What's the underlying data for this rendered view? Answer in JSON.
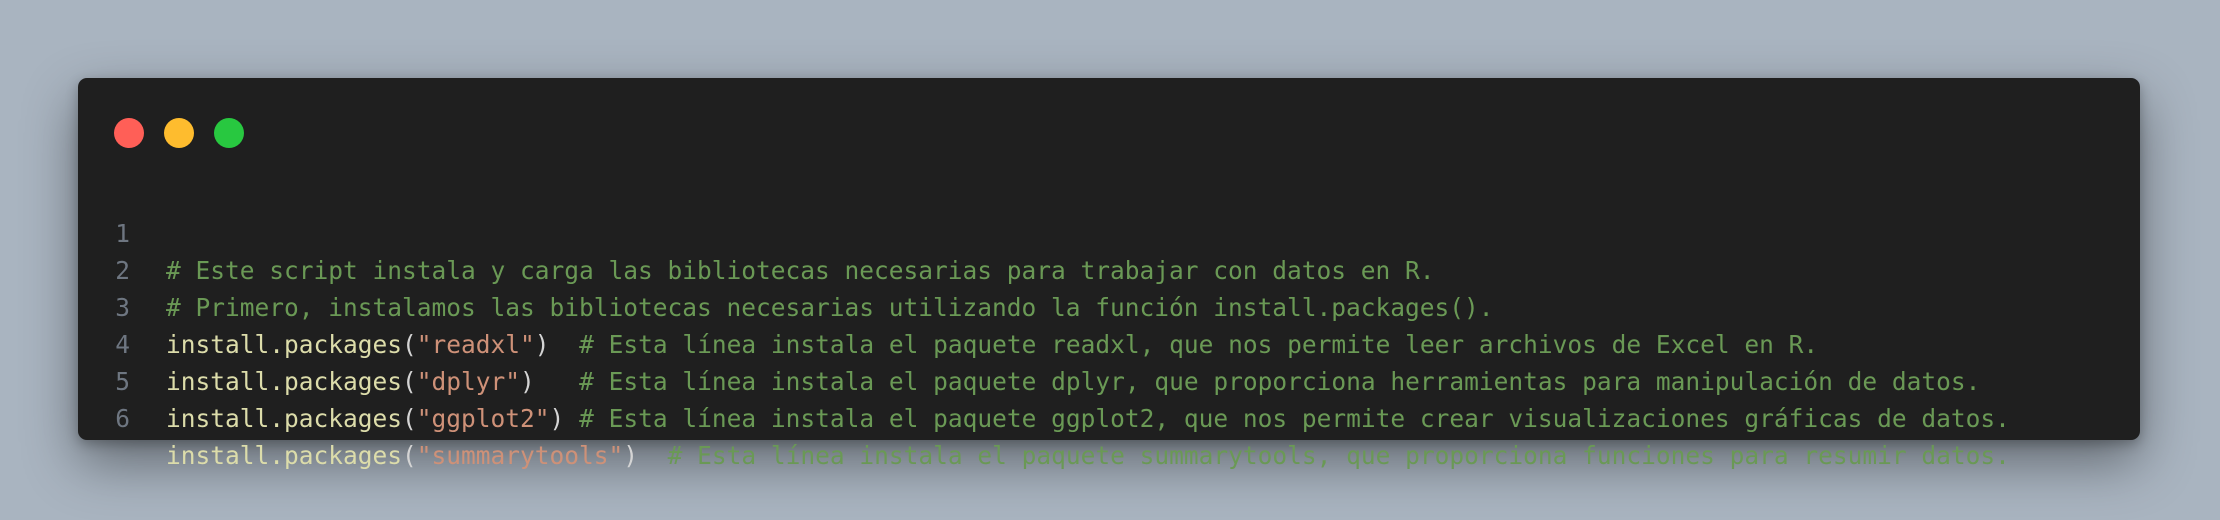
{
  "window": {
    "dots": [
      {
        "name": "close",
        "color": "#ff5f57"
      },
      {
        "name": "minimize",
        "color": "#febc2e"
      },
      {
        "name": "maximize",
        "color": "#28c840"
      }
    ]
  },
  "colors": {
    "background": "#a9b4c0",
    "editor": "#1f1f1f",
    "comment": "#6a9955",
    "string": "#ce9178",
    "function": "#dcdcaa",
    "line_number": "#6e7681"
  },
  "code": {
    "lines": [
      {
        "number": "1",
        "comment": "# Este script instala y carga las bibliotecas necesarias para trabajar con datos en R."
      },
      {
        "number": "2",
        "comment": "# Primero, instalamos las bibliotecas necesarias utilizando la función install.packages()."
      },
      {
        "number": "3",
        "fn": "install.packages",
        "open": "(",
        "arg": "\"readxl\"",
        "close": ")",
        "gap": "  ",
        "comment": "# Esta línea instala el paquete readxl, que nos permite leer archivos de Excel en R."
      },
      {
        "number": "4",
        "fn": "install.packages",
        "open": "(",
        "arg": "\"dplyr\"",
        "close": ")",
        "gap": "   ",
        "comment": "# Esta línea instala el paquete dplyr, que proporciona herramientas para manipulación de datos."
      },
      {
        "number": "5",
        "fn": "install.packages",
        "open": "(",
        "arg": "\"ggplot2\"",
        "close": ")",
        "gap": " ",
        "comment": "# Esta línea instala el paquete ggplot2, que nos permite crear visualizaciones gráficas de datos."
      },
      {
        "number": "6",
        "fn": "install.packages",
        "open": "(",
        "arg": "\"summarytools\"",
        "close": ")",
        "gap": "  ",
        "comment": "# Esta línea instala el paquete summarytools, que proporciona funciones para resumir datos."
      }
    ]
  }
}
